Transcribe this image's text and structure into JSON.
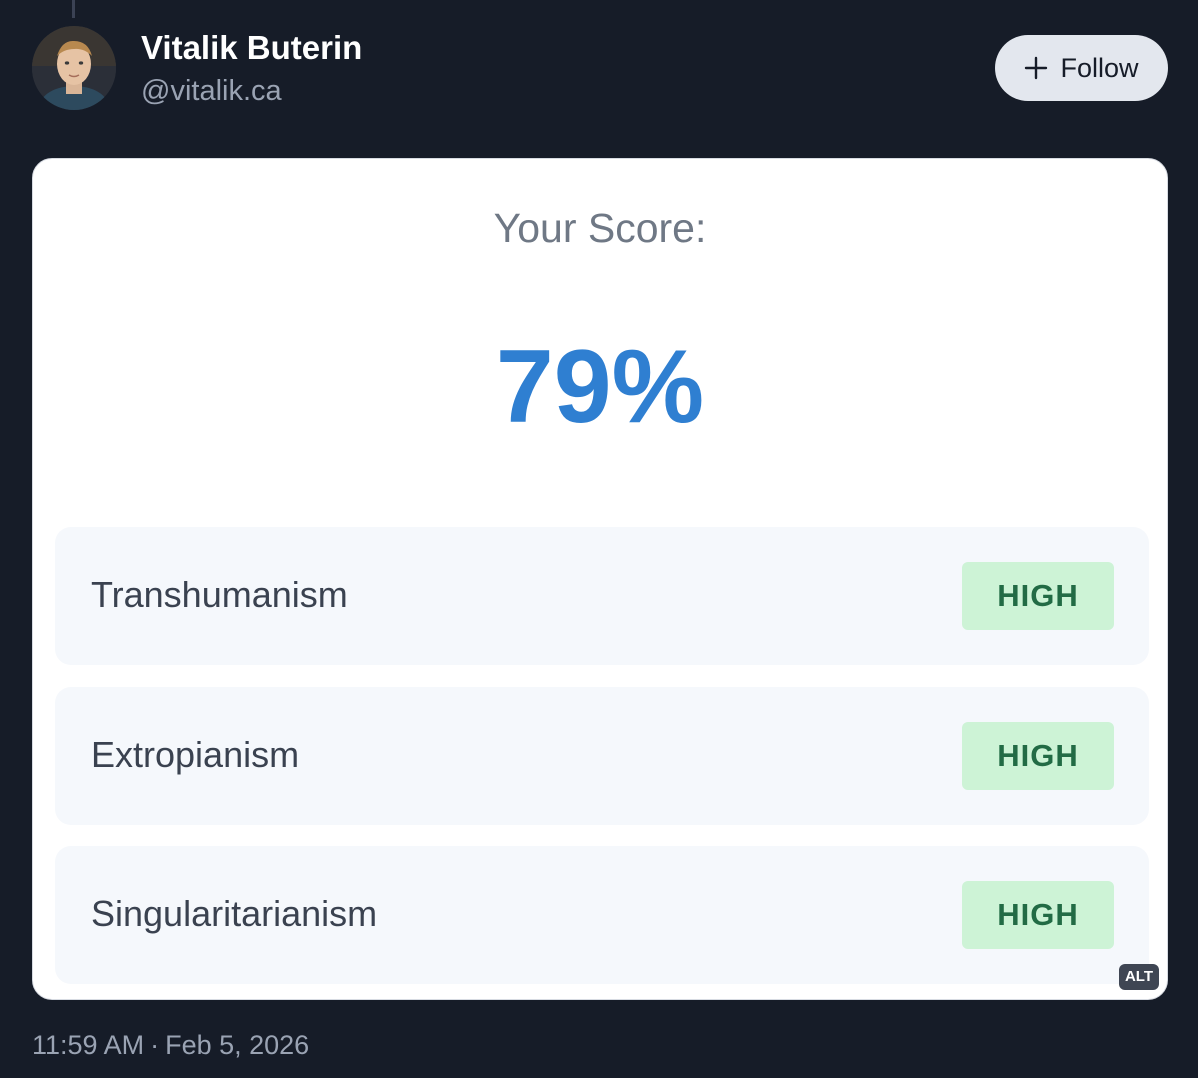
{
  "author": {
    "name": "Vitalik Buterin",
    "handle": "@vitalik.ca",
    "avatar_icon": "profile-photo"
  },
  "follow_button": {
    "label": "Follow",
    "icon": "plus-icon"
  },
  "image": {
    "score_label": "Your Score:",
    "score_value": "79%",
    "score_percent": 79,
    "traits": [
      {
        "name": "Transhumanism",
        "level": "HIGH"
      },
      {
        "name": "Extropianism",
        "level": "HIGH"
      },
      {
        "name": "Singularitarianism",
        "level": "HIGH"
      }
    ],
    "alt_badge": "ALT"
  },
  "timestamp": {
    "time": "11:59 AM",
    "separator": "·",
    "date": "Feb 5, 2026"
  },
  "colors": {
    "background": "#161c28",
    "accent_score": "#2f7fd1",
    "high_badge_bg": "#cdf3d6",
    "high_badge_text": "#226b45"
  }
}
